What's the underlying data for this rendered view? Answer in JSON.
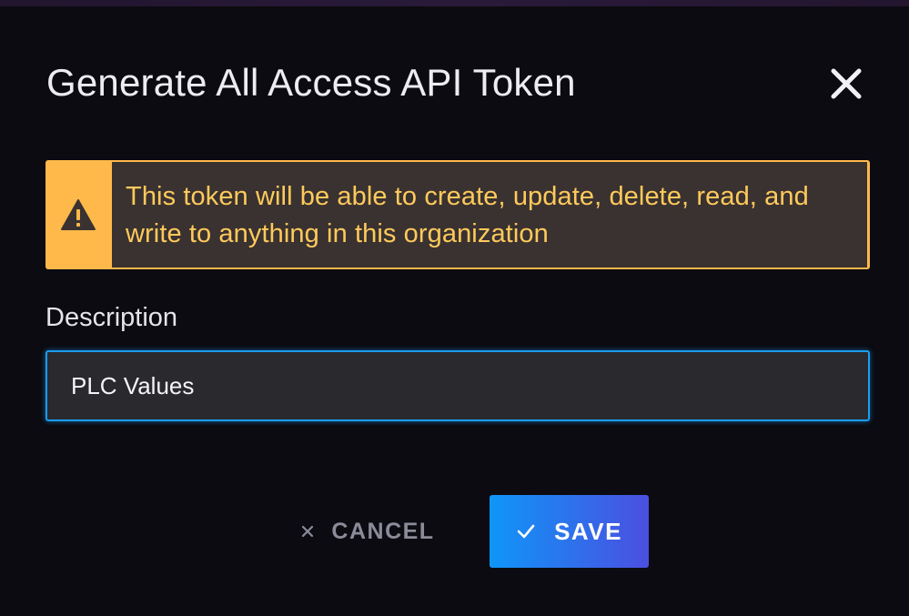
{
  "dialog": {
    "title": "Generate All Access API Token",
    "close_icon": "close-icon"
  },
  "alert": {
    "icon": "warning-triangle-icon",
    "message": "This token will be able to create, update, delete, read, and write to anything in this organization",
    "colors": {
      "stripe": "#ffb94a",
      "text": "#ffca5c",
      "background": "#3a3230"
    }
  },
  "description": {
    "label": "Description",
    "value": "PLC Values",
    "focused": true
  },
  "actions": {
    "cancel_label": "CANCEL",
    "cancel_icon": "close-x-icon",
    "save_label": "SAVE",
    "save_icon": "checkmark-icon",
    "save_gradient": [
      "#0f96f8",
      "#4b4fe0"
    ]
  },
  "colors": {
    "background": "#0b0b11",
    "focus_border": "#1a9cf0"
  }
}
